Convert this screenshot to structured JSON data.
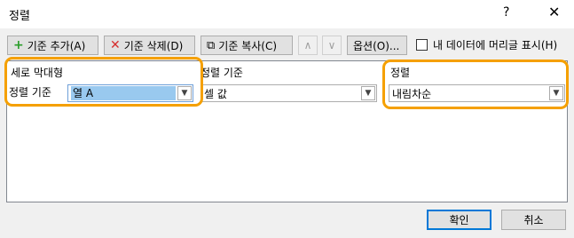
{
  "window": {
    "title": "정렬",
    "help": "?",
    "close": "✕"
  },
  "toolbar": {
    "add_level": "기준 추가(A)",
    "delete_level": "기준 삭제(D)",
    "copy_level": "기준 복사(C)",
    "move_up": "∧",
    "move_down": "∨",
    "options": "옵션(O)...",
    "has_header_label": "내 데이터에 머리글 표시(H)",
    "has_header_checked": false
  },
  "columns": {
    "column_header": "세로 막대형",
    "sort_on_header": "정렬 기준",
    "order_header": "정렬"
  },
  "rows": [
    {
      "label": "정렬 기준",
      "column": "열 A",
      "sort_on": "셀 값",
      "order": "내림차순"
    }
  ],
  "buttons": {
    "ok": "확인",
    "cancel": "취소"
  },
  "colors": {
    "highlight": "#f5a000",
    "selection": "#99c9ef",
    "ok_border": "#0078d7"
  }
}
